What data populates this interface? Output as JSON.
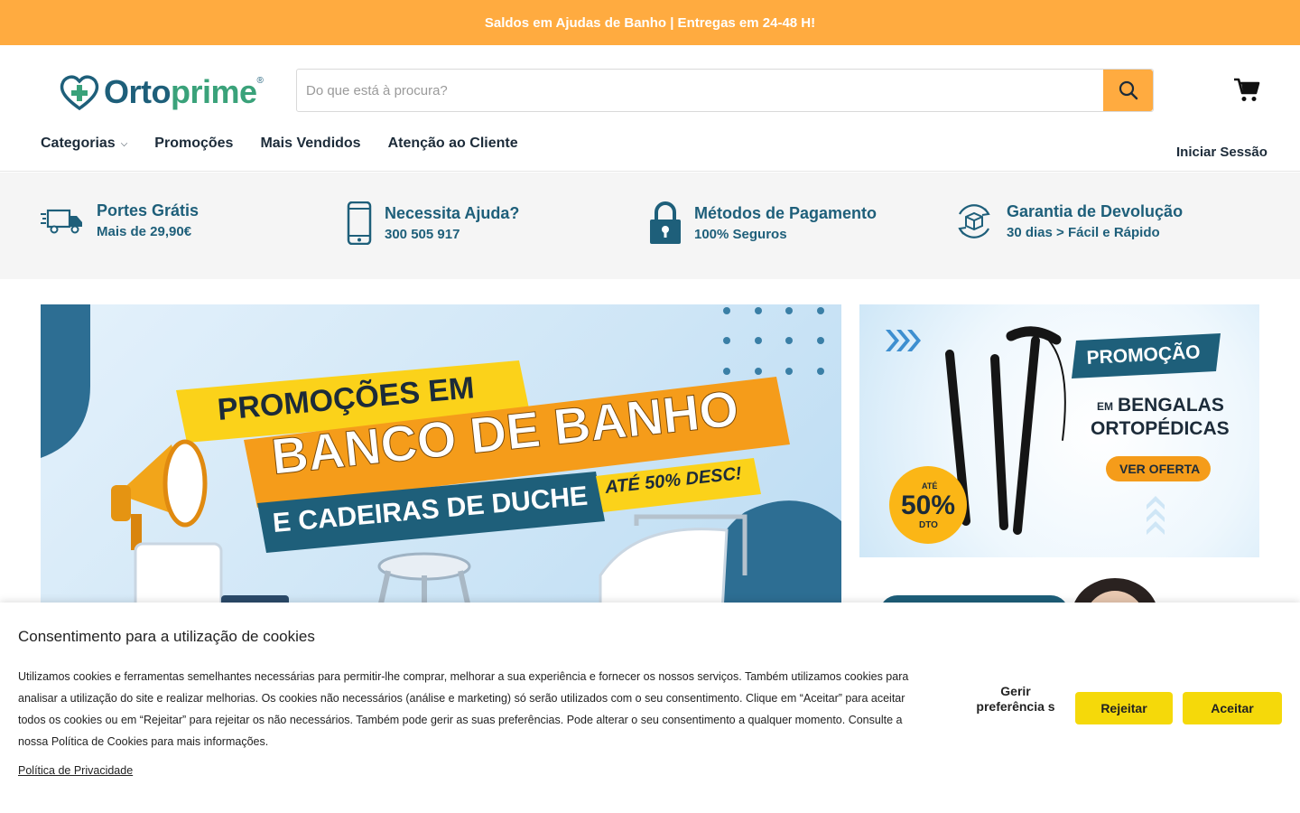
{
  "announcement": "Saldos em Ajudas de Banho | Entregas em 24-48 H!",
  "header": {
    "logo_text_1": "Orto",
    "logo_text_2": "prime",
    "logo_reg": "®",
    "search_placeholder": "Do que está à procura?",
    "nav": [
      "Categorias",
      "Promoções",
      "Mais Vendidos",
      "Atenção ao Cliente"
    ],
    "login": "Iniciar Sessão"
  },
  "features": [
    {
      "icon": "truck-icon",
      "title": "Portes Grátis",
      "subtitle": "Mais de 29,90€"
    },
    {
      "icon": "phone-icon",
      "title": "Necessita Ajuda?",
      "subtitle": "300 505 917"
    },
    {
      "icon": "lock-icon",
      "title": "Métodos de Pagamento",
      "subtitle": "100% Seguros"
    },
    {
      "icon": "return-box-icon",
      "title": "Garantia de Devolução",
      "subtitle": "30 dias > Fácil e Rápido"
    }
  ],
  "banner_main": {
    "line1": "PROMOÇÕES EM",
    "line2": "BANCO DE BANHO",
    "line3": "E CADEIRAS DE DUCHE",
    "badge": "ATÉ 50% DESC!"
  },
  "banner_side": {
    "title": "PROMOÇÃO",
    "em": "EM",
    "line1": "BENGALAS",
    "line2": "ORTOPÉDICAS",
    "cta": "VER OFERTA",
    "badge_top": "ATÉ",
    "badge_value": "50%",
    "badge_bottom": "DTO"
  },
  "cookie": {
    "title": "Consentimento para a utilização de cookies",
    "text": "Utilizamos cookies e ferramentas semelhantes necessárias para permitir-lhe comprar, melhorar a sua experiência e fornecer os nossos serviços. Também utilizamos cookies para analisar a utilização do site e realizar melhorias. Os cookies não necessários (análise e marketing) só serão utilizados com o seu consentimento. Clique em “Aceitar” para aceitar todos os cookies ou em “Rejeitar” para rejeitar os não necessários. Também pode gerir as suas preferências. Pode alterar o seu consentimento a qualquer momento. Consulte a nossa Política de Cookies para mais informações.",
    "privacy_link": "Política de Privacidade",
    "manage": "Gerir preferência s",
    "reject": "Rejeitar",
    "accept": "Aceitar"
  },
  "colors": {
    "accent_orange": "#ffab40",
    "brand_teal": "#1e5f7a",
    "brand_green": "#3aa27a",
    "cookie_button": "#f5d90a"
  }
}
